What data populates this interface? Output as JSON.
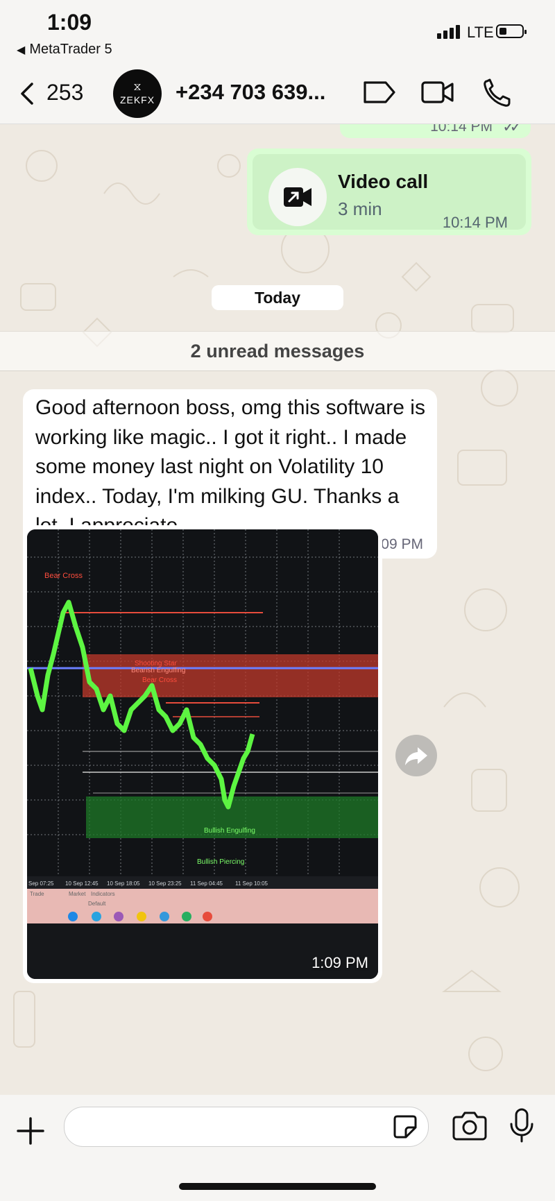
{
  "status_bar": {
    "time": "1:09",
    "back_app": "MetaTrader 5",
    "network": "LTE",
    "signal_bars": 4,
    "battery_level": 0.2
  },
  "header": {
    "back_count": "253",
    "avatar_text": "ZEKFX",
    "contact_name": "+234 703 639...",
    "icons": [
      "chevron-left-icon",
      "label-icon",
      "video-camera-icon",
      "phone-icon"
    ]
  },
  "messages": {
    "prev_time": "10:14 PM",
    "video_call": {
      "title": "Video call",
      "duration": "3 min",
      "time": "10:14 PM"
    },
    "date_divider": "Today",
    "unread_divider": "2 unread messages",
    "text_message": {
      "text": "Good afternoon boss, omg this software is working like magic.. I got it right.. I made some money last night on Volatility 10 index.. Today, I'm milking GU. Thanks a lot, I appreciate",
      "time": "1:09 PM"
    },
    "image_message": {
      "time": "1:09 PM",
      "chart_annotations": {
        "bear_cross_top": "Bear Cross",
        "shooting_star": "Shooting Star",
        "bearish_engulfing": "Bearish Engulfing",
        "bear_cross_mid": "Bear Cross",
        "bullish_engulfing": "Bullish Engulfing",
        "bullish_piercing": "Bullish Piercing"
      },
      "time_axis": [
        "Sep 07:25",
        "10 Sep 12:45",
        "10 Sep 18:05",
        "10 Sep 23:25",
        "11 Sep 04:45",
        "11 Sep 10:05"
      ],
      "tab_labels": [
        "Trade",
        "Market",
        "Indicators",
        "Default"
      ]
    }
  },
  "composer": {
    "placeholder": "",
    "icons": [
      "plus-icon",
      "sticker-icon",
      "camera-icon",
      "microphone-icon"
    ]
  },
  "colors": {
    "outgoing_bubble": "#d9fdd3",
    "incoming_bubble": "#ffffff",
    "wallpaper": "#efeae2",
    "chart_candles": "#5df542",
    "chart_red_zone": "#c0392b",
    "chart_green_zone": "#1e7a27"
  }
}
